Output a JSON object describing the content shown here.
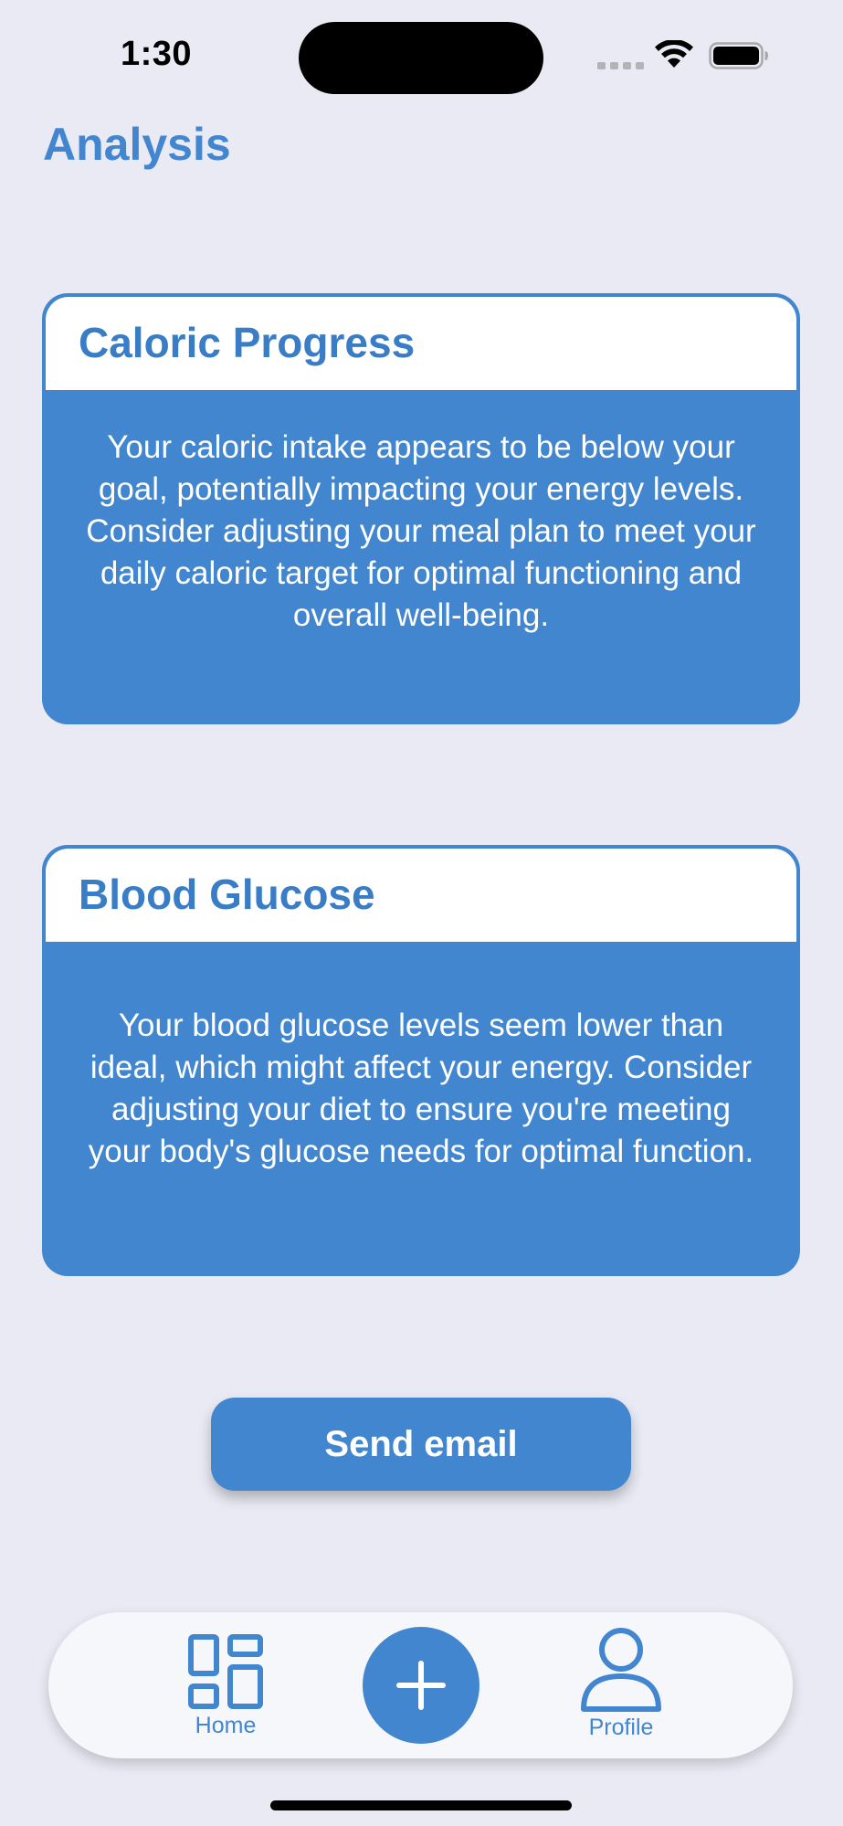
{
  "status_bar": {
    "time": "1:30",
    "icons": [
      "cellular-signal-icon",
      "wifi-icon",
      "battery-icon"
    ]
  },
  "header": {
    "title": "Analysis"
  },
  "cards": [
    {
      "title": "Caloric Progress",
      "body": "Your caloric intake appears to be below your goal, potentially impacting your energy levels. Consider adjusting your meal plan to meet your daily caloric target for optimal functioning and overall well-being."
    },
    {
      "title": "Blood Glucose",
      "body": "Your blood glucose levels seem lower than ideal, which might affect your energy. Consider adjusting your diet to ensure you're meeting your body's glucose needs for optimal function."
    }
  ],
  "actions": {
    "send_email_label": "Send email"
  },
  "tab_bar": {
    "home_label": "Home",
    "home_icon": "grid-icon",
    "add_icon": "plus-icon",
    "profile_label": "Profile",
    "profile_icon": "person-icon"
  },
  "colors": {
    "accent": "#4286cf",
    "background": "#e9eaf4",
    "card_header": "#ffffff",
    "tab_bar": "#f6f7fb"
  }
}
